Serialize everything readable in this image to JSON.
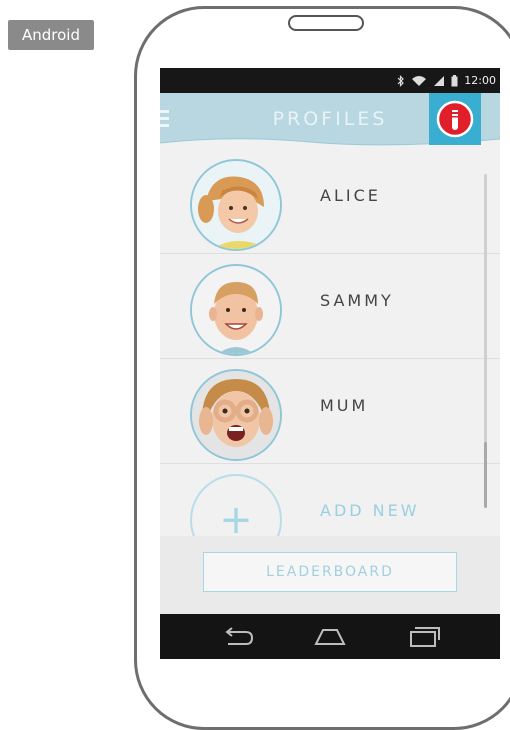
{
  "platform_label": "Android",
  "status_bar": {
    "time": "12:00",
    "icons": [
      "bluetooth-icon",
      "wifi-icon",
      "signal-icon",
      "battery-icon"
    ]
  },
  "app_bar": {
    "title": "PROFILES",
    "menu_icon": "hamburger-menu-icon",
    "logo_icon": "toothbrush-logo-icon",
    "background_color": "#b9d7e0",
    "logo_color": "#e01f2b"
  },
  "profiles": [
    {
      "name": "ALICE",
      "avatar": "girl-avatar"
    },
    {
      "name": "SAMMY",
      "avatar": "boy-avatar"
    },
    {
      "name": "MUM",
      "avatar": "woman-avatar"
    }
  ],
  "add_new": {
    "label": "ADD NEW",
    "icon": "plus-icon"
  },
  "leaderboard_button": {
    "label": "LEADERBOARD"
  },
  "nav_bar": {
    "buttons": [
      "back-icon",
      "home-icon",
      "recent-apps-icon"
    ]
  },
  "colors": {
    "accent": "#3aaed0",
    "light_accent": "#a6d7e5"
  }
}
